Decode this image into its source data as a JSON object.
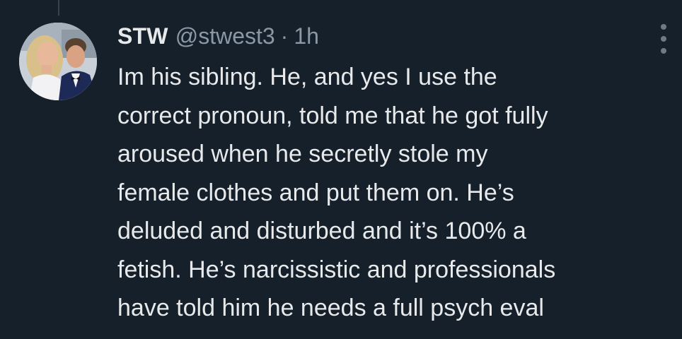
{
  "tweet": {
    "display_name": "STW",
    "handle": "@stwest3",
    "separator": "·",
    "time": "1h",
    "text_lines": [
      "Im his sibling. He, and yes I use the",
      "correct pronoun, told me that he got fully",
      "aroused when he secretly stole my",
      "female clothes and put them on. He’s",
      "deluded and disturbed and it’s 100% a",
      "fetish. He’s narcissistic and professionals",
      "have told him he needs a full psych eval"
    ],
    "avatar": "profile-photo",
    "more_icon": "more-options-icon"
  },
  "colors": {
    "background": "#15202b",
    "text_primary": "#e7e9ea",
    "text_secondary": "#8b98a5",
    "thread_line": "#38444d"
  }
}
